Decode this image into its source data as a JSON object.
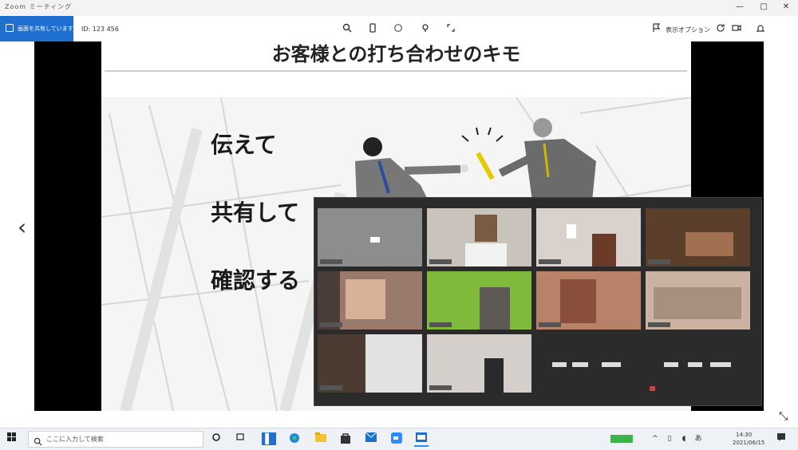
{
  "window": {
    "title": "Zoom ミーティング",
    "minimize": "—",
    "maximize": "□",
    "close": "✕"
  },
  "toolbar": {
    "share_button_label": "画面を共有しています",
    "meeting_id": "ID: 123 456",
    "view_label": "表示オプション",
    "icons": [
      "search-icon",
      "phone-icon",
      "circle-icon",
      "pin-icon",
      "expand-icon"
    ]
  },
  "slide": {
    "title": "お客様との打ち合わせのキモ",
    "point1": "伝えて",
    "point2": "共有して",
    "point3": "確認する"
  },
  "nav": {
    "prev": "‹"
  },
  "gallery": {
    "participants": 12
  },
  "taskbar": {
    "search_placeholder": "ここに入力して検索",
    "time": "14:30",
    "date": "2021/06/15"
  }
}
